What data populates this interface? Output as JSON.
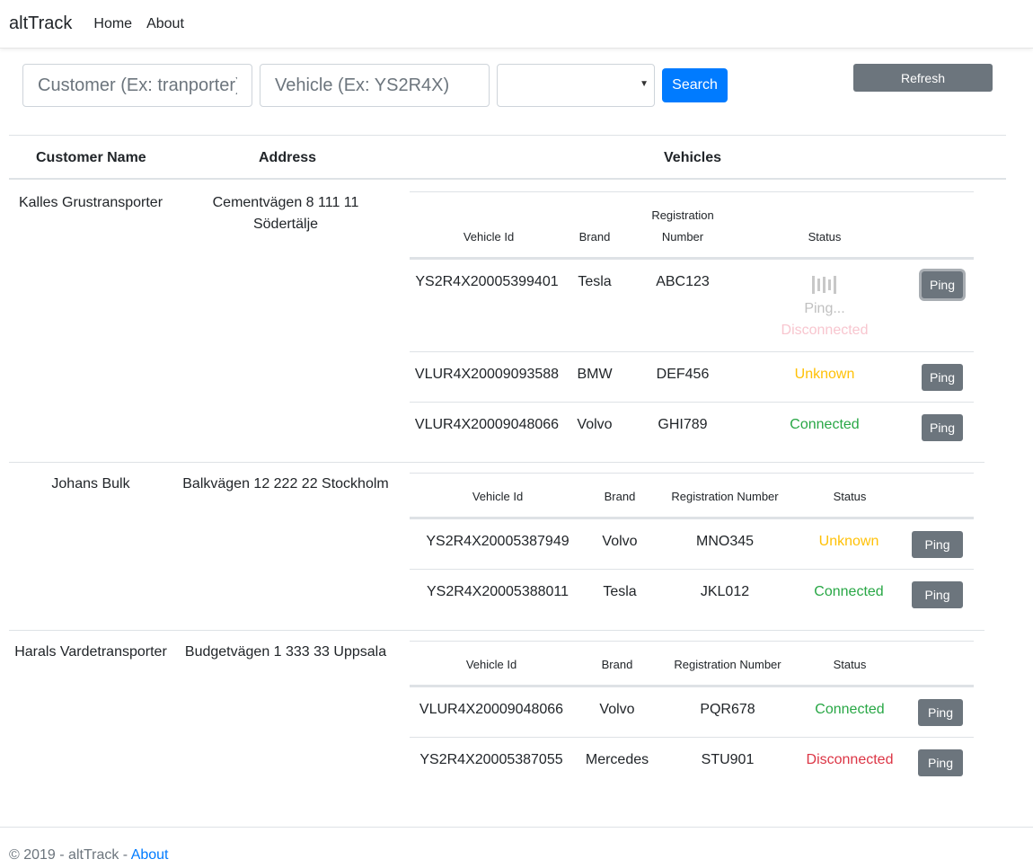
{
  "nav": {
    "brand": "altTrack",
    "links": [
      "Home",
      "About"
    ]
  },
  "search": {
    "customer_placeholder": "Customer (Ex: tranporter)",
    "vehicle_placeholder": "Vehicle (Ex: YS2R4X)",
    "status_select_value": "",
    "search_label": "Search",
    "refresh_label": "Refresh"
  },
  "table": {
    "headers": {
      "customer": "Customer Name",
      "address": "Address",
      "vehicles": "Vehicles"
    },
    "customers": [
      {
        "name": "Kalles Grustransporter",
        "address": "Cementvägen 8 111 11 Södertälje",
        "vehicle_headers": [
          "Vehicle Id",
          "Brand",
          "Registration Number",
          "Status"
        ],
        "vehicles": [
          {
            "id": "YS2R4X20005399401",
            "brand": "Tesla",
            "reg": "ABC123",
            "status": "Disconnected",
            "pinging": "Ping...",
            "ping": "Ping"
          },
          {
            "id": "VLUR4X20009093588",
            "brand": "BMW",
            "reg": "DEF456",
            "status": "Unknown",
            "ping": "Ping"
          },
          {
            "id": "VLUR4X20009048066",
            "brand": "Volvo",
            "reg": "GHI789",
            "status": "Connected",
            "ping": "Ping"
          }
        ]
      },
      {
        "name": "Johans Bulk",
        "address": "Balkvägen 12 222 22 Stockholm",
        "vehicle_headers": [
          "Vehicle Id",
          "Brand",
          "Registration Number",
          "Status"
        ],
        "vehicles": [
          {
            "id": "YS2R4X20005387949",
            "brand": "Volvo",
            "reg": "MNO345",
            "status": "Unknown",
            "ping": "Ping"
          },
          {
            "id": "YS2R4X20005388011",
            "brand": "Tesla",
            "reg": "JKL012",
            "status": "Connected",
            "ping": "Ping"
          }
        ]
      },
      {
        "name": "Harals Vardetransporter",
        "address": "Budgetvägen 1 333 33 Uppsala",
        "vehicle_headers": [
          "Vehicle Id",
          "Brand",
          "Registration Number",
          "Status"
        ],
        "vehicles": [
          {
            "id": "VLUR4X20009048066",
            "brand": "Volvo",
            "reg": "PQR678",
            "status": "Connected",
            "ping": "Ping"
          },
          {
            "id": "YS2R4X20005387055",
            "brand": "Mercedes",
            "reg": "STU901",
            "status": "Disconnected",
            "ping": "Ping"
          }
        ]
      }
    ]
  },
  "footer": {
    "copyright": "© 2019 - altTrack - ",
    "about_link": "About"
  },
  "colors": {
    "primary": "#007bff",
    "secondary": "#6c757d",
    "connected": "#28a745",
    "unknown": "#ffc107",
    "disconnected": "#dc3545"
  }
}
